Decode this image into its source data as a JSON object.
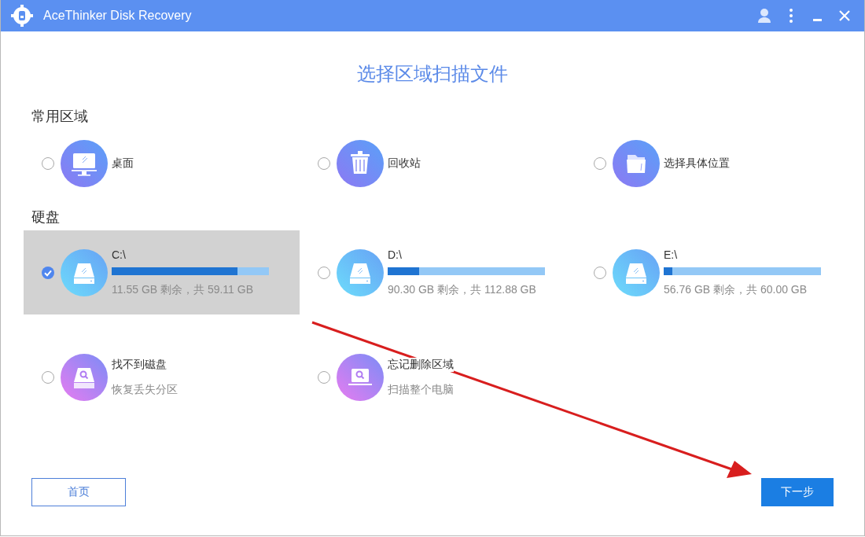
{
  "window": {
    "title": "AceThinker Disk Recovery"
  },
  "heading": "选择区域扫描文件",
  "common": {
    "label": "常用区域",
    "items": [
      {
        "kind": "desktop",
        "label": "桌面",
        "selected": false
      },
      {
        "kind": "recycle",
        "label": "回收站",
        "selected": false
      },
      {
        "kind": "folder",
        "label": "选择具体位置",
        "selected": false
      }
    ]
  },
  "drives": {
    "label": "硬盘",
    "items": [
      {
        "kind": "drive",
        "label": "C:\\",
        "level": 0.8,
        "reading": "11.55 GB 剩余，共 59.11 GB",
        "selected": true
      },
      {
        "kind": "drive",
        "label": "D:\\",
        "level": 0.2,
        "reading": "90.30 GB 剩余，共 112.88 GB",
        "selected": false
      },
      {
        "kind": "drive",
        "label": "E:\\",
        "level": 0.054,
        "reading": "56.76 GB 剩余，共 60.00 GB",
        "selected": false
      },
      {
        "kind": "lost",
        "label": "找不到磁盘",
        "subtitle": "恢复丢失分区",
        "selected": false
      },
      {
        "kind": "forgot",
        "label": "忘记删除区域",
        "subtitle": "扫描整个电脑",
        "selected": false
      }
    ]
  },
  "buttons": [
    {
      "kind": "secondary",
      "label": "首页"
    },
    {
      "kind": "primary",
      "label": "下一步"
    }
  ]
}
